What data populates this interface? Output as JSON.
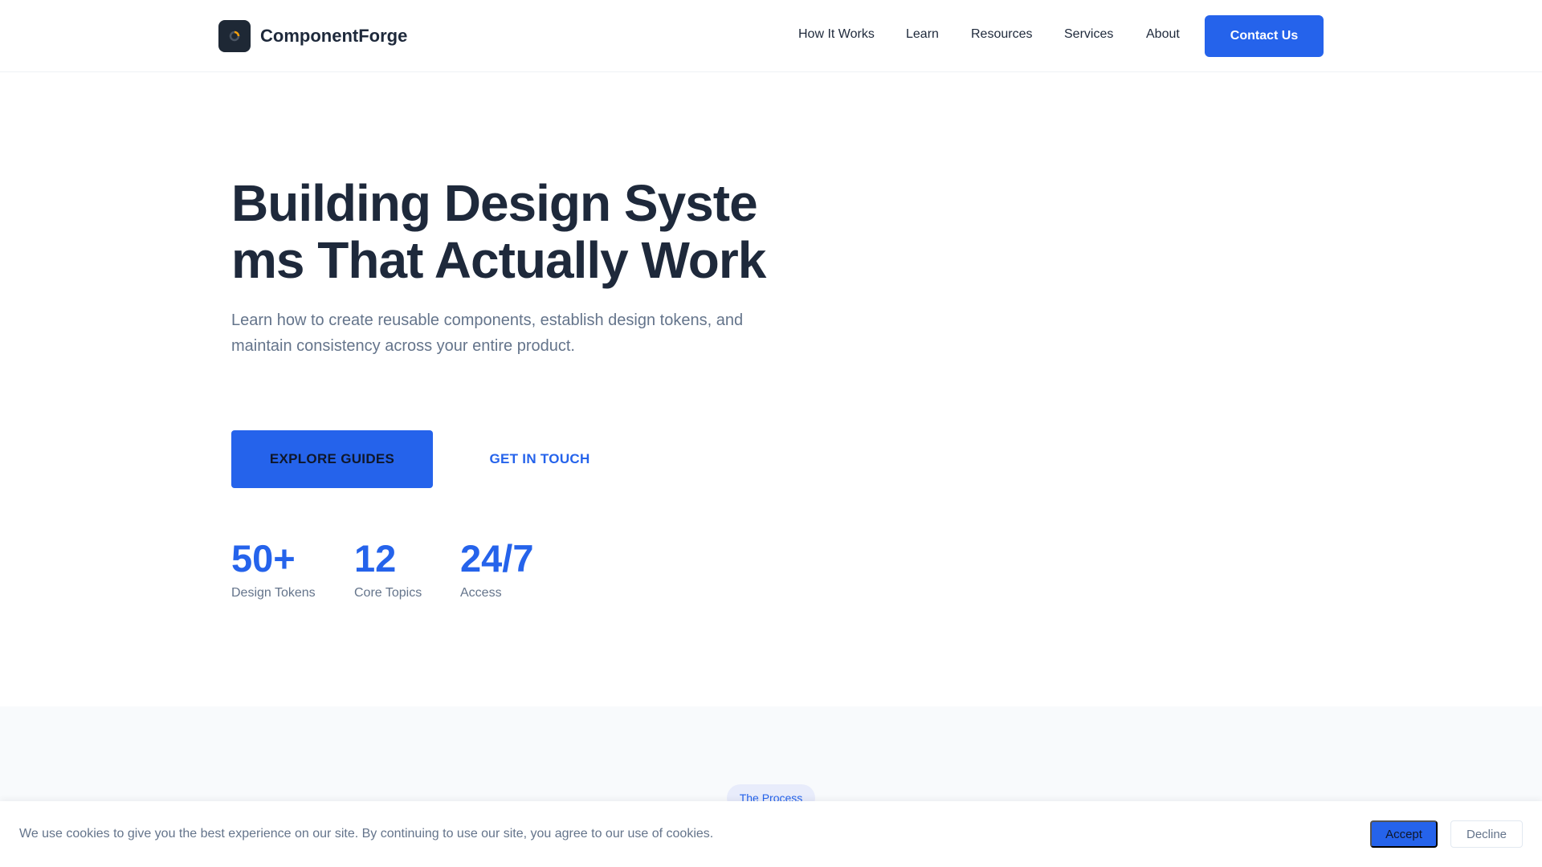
{
  "header": {
    "brand": "ComponentForge",
    "logo_icon": "spinner-ring-icon",
    "nav": [
      {
        "label": "How It Works"
      },
      {
        "label": "Learn"
      },
      {
        "label": "Resources"
      },
      {
        "label": "Services"
      },
      {
        "label": "About"
      }
    ],
    "cta": "Contact Us"
  },
  "hero": {
    "title": "Building Design Systems That Actually Work",
    "subtitle": "Learn how to create reusable components, establish design tokens, and maintain consistency across your entire product.",
    "primary_button": "EXPLORE GUIDES",
    "secondary_button": "GET IN TOUCH",
    "stats": [
      {
        "value": "50+",
        "label": "Design Tokens"
      },
      {
        "value": "12",
        "label": "Core Topics"
      },
      {
        "value": "24/7",
        "label": "Access"
      }
    ]
  },
  "process": {
    "badge": "The Process"
  },
  "cookie": {
    "message": "We use cookies to give you the best experience on our site. By continuing to use our site, you agree to our use of cookies.",
    "accept": "Accept",
    "decline": "Decline"
  },
  "colors": {
    "accent": "#2563eb",
    "heading": "#1e293b",
    "muted": "#64748b",
    "section_bg": "#f8fafc",
    "logo_bg": "#1e2835"
  }
}
